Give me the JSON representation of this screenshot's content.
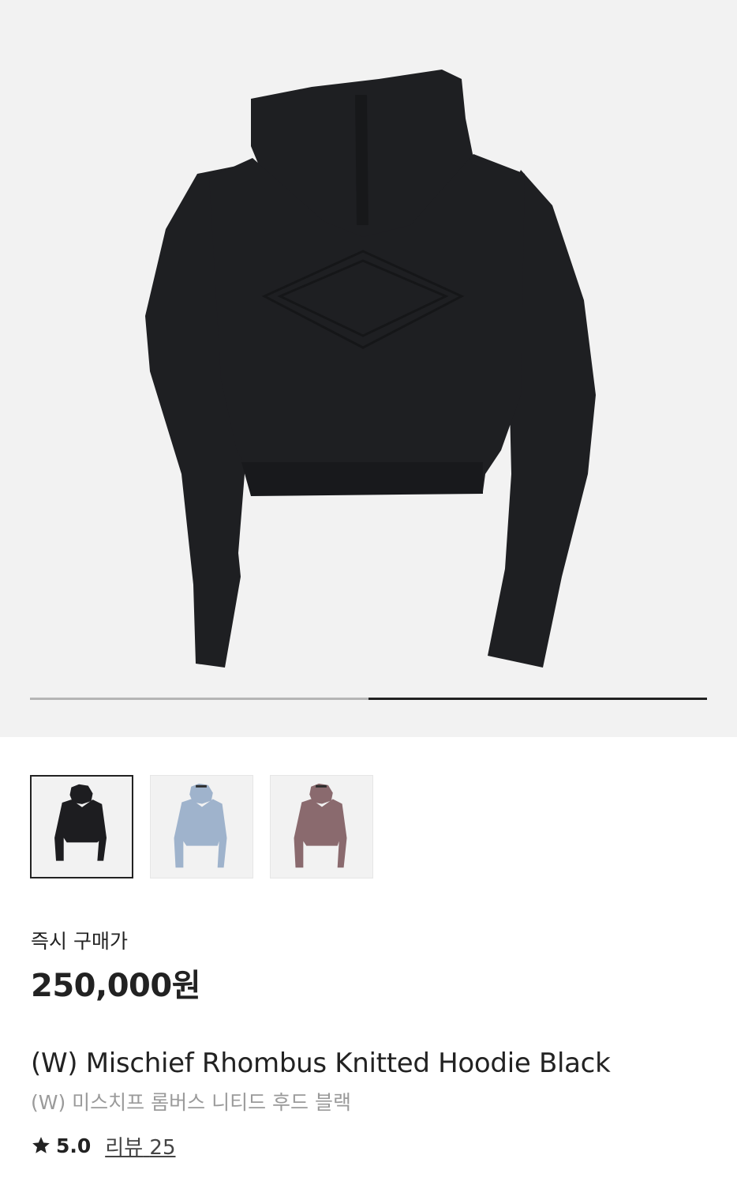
{
  "product_image": {
    "icon": "hoodie-back-image",
    "garment_color": "#1e1f22",
    "background_color": "#f2f2f2",
    "slide_progress": 1.0,
    "slide_index": 2,
    "slide_total": 2
  },
  "thumbnails": [
    {
      "icon": "black-hoodie-thumbnail",
      "color": "#1d1d20",
      "selected": true
    },
    {
      "icon": "light-blue-hoodie-thumbnail",
      "color": "#9fb3cc",
      "selected": false
    },
    {
      "icon": "mauve-hoodie-thumbnail",
      "color": "#8a6a6e",
      "selected": false
    }
  ],
  "pricing": {
    "label": "즉시 구매가",
    "price": "250,000원"
  },
  "product": {
    "name_en": "(W) Mischief Rhombus Knitted Hoodie Black",
    "name_ko": "(W) 미스치프 롬버스 니티드 후드 블랙"
  },
  "rating": {
    "icon": "star-icon",
    "score": "5.0",
    "review_label": "리뷰",
    "review_count": "25"
  }
}
